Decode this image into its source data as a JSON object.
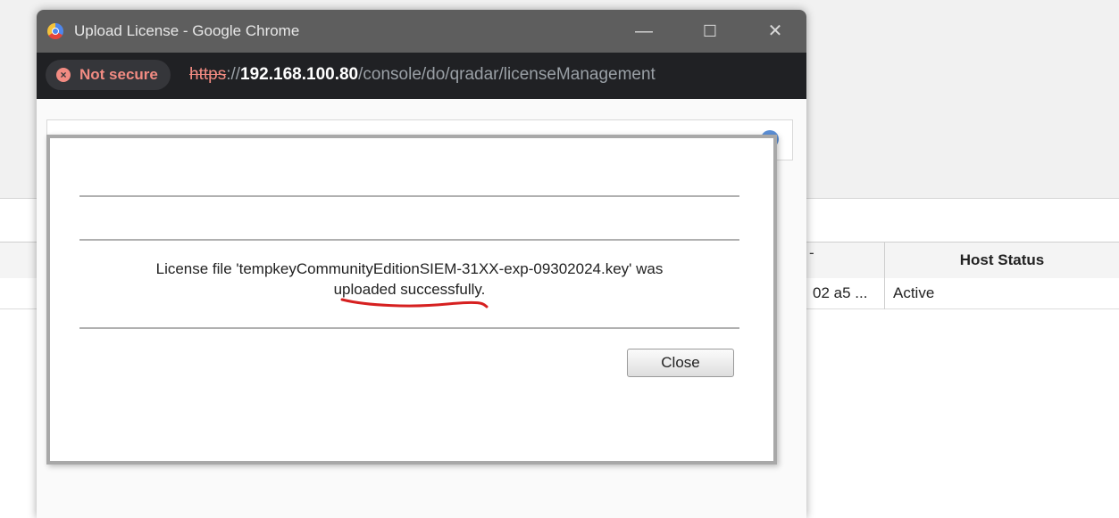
{
  "window": {
    "title": "Upload License - Google Chrome",
    "minimize_glyph": "—",
    "maximize_glyph": "☐",
    "close_glyph": "✕"
  },
  "address_bar": {
    "security_label": "Not secure",
    "protocol": "https",
    "separator": "://",
    "host": "192.168.100.80",
    "path": "/console/do/qradar/licenseManagement"
  },
  "background_table": {
    "truncated_header": "-",
    "host_status_header": "Host Status",
    "row": {
      "truncated_value": "02 a5 ...",
      "host_status": "Active"
    }
  },
  "dialog": {
    "message_line1": "License file 'tempkeyCommunityEditionSIEM-31XX-exp-09302024.key' was",
    "message_line2": "uploaded successfully.",
    "close_label": "Close"
  },
  "colors": {
    "titlebar": "#5e5e5e",
    "urlbar": "#202124",
    "not_secure": "#f28b82",
    "annotation_underline": "#d62020"
  },
  "icons": [
    "chrome-logo-icon",
    "not-secure-warning-icon",
    "help-icon"
  ]
}
